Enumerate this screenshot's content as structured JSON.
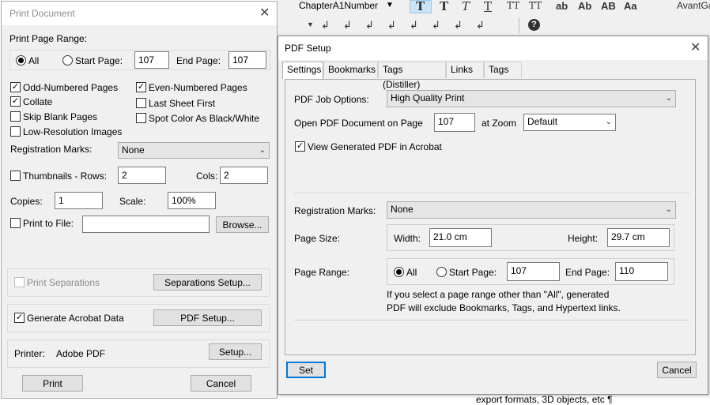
{
  "toolbar": {
    "style_dropdown": "ChapterA1Number",
    "font_name": "AvantGa",
    "glyphs": [
      "T",
      "T",
      "T",
      "T",
      "TT",
      "TT",
      "ab",
      "Ab",
      "AB",
      "Aa"
    ],
    "second_row_glyphs": [
      "↲",
      "↲",
      "↲",
      "↲",
      "↲",
      "↲",
      "↲",
      "↲"
    ],
    "help": "?"
  },
  "background_text": "export formats, 3D objects, etc ¶",
  "print_dialog": {
    "title": "Print Document",
    "page_range_label": "Print Page Range:",
    "all_label": "All",
    "start_page_label": "Start Page:",
    "start_page_value": "107",
    "end_page_label": "End Page:",
    "end_page_value": "107",
    "odd_pages": "Odd-Numbered Pages",
    "even_pages": "Even-Numbered Pages",
    "collate": "Collate",
    "last_sheet_first": "Last Sheet First",
    "skip_blank": "Skip Blank Pages",
    "spot_color": "Spot Color As Black/White",
    "low_res": "Low-Resolution Images",
    "registration_marks_label": "Registration Marks:",
    "registration_marks_value": "None",
    "thumbnails_label": "Thumbnails - Rows:",
    "thumbnails_rows": "2",
    "cols_label": "Cols:",
    "cols_value": "2",
    "copies_label": "Copies:",
    "copies_value": "1",
    "scale_label": "Scale:",
    "scale_value": "100%",
    "print_to_file": "Print to File:",
    "print_to_file_value": "",
    "browse": "Browse...",
    "print_separations": "Print Separations",
    "separations_setup": "Separations Setup...",
    "generate_acrobat": "Generate Acrobat Data",
    "pdf_setup": "PDF Setup...",
    "printer_label": "Printer:",
    "printer_value": "Adobe PDF",
    "setup": "Setup...",
    "print": "Print",
    "cancel": "Cancel"
  },
  "pdf_dialog": {
    "title": "PDF Setup",
    "tabs": [
      "Settings",
      "Bookmarks",
      "Tags (Distiller)",
      "Links",
      "Tags"
    ],
    "job_options_label": "PDF Job Options:",
    "job_options_value": "High Quality Print",
    "open_on_page_label": "Open PDF Document on Page",
    "open_on_page_value": "107",
    "at_zoom_label": "at Zoom",
    "zoom_value": "Default",
    "view_generated": "View Generated PDF in Acrobat",
    "registration_marks_label": "Registration Marks:",
    "registration_marks_value": "None",
    "page_size_label": "Page Size:",
    "width_label": "Width:",
    "width_value": "21.0 cm",
    "height_label": "Height:",
    "height_value": "29.7 cm",
    "page_range_label": "Page Range:",
    "all_label": "All",
    "start_page_label": "Start Page:",
    "start_page_value": "107",
    "end_page_label": "End Page:",
    "end_page_value": "110",
    "note_line1": "If you select a page range other than \"All\",  generated",
    "note_line2": "PDF will exclude Bookmarks, Tags, and Hypertext links.",
    "set": "Set",
    "cancel": "Cancel"
  }
}
